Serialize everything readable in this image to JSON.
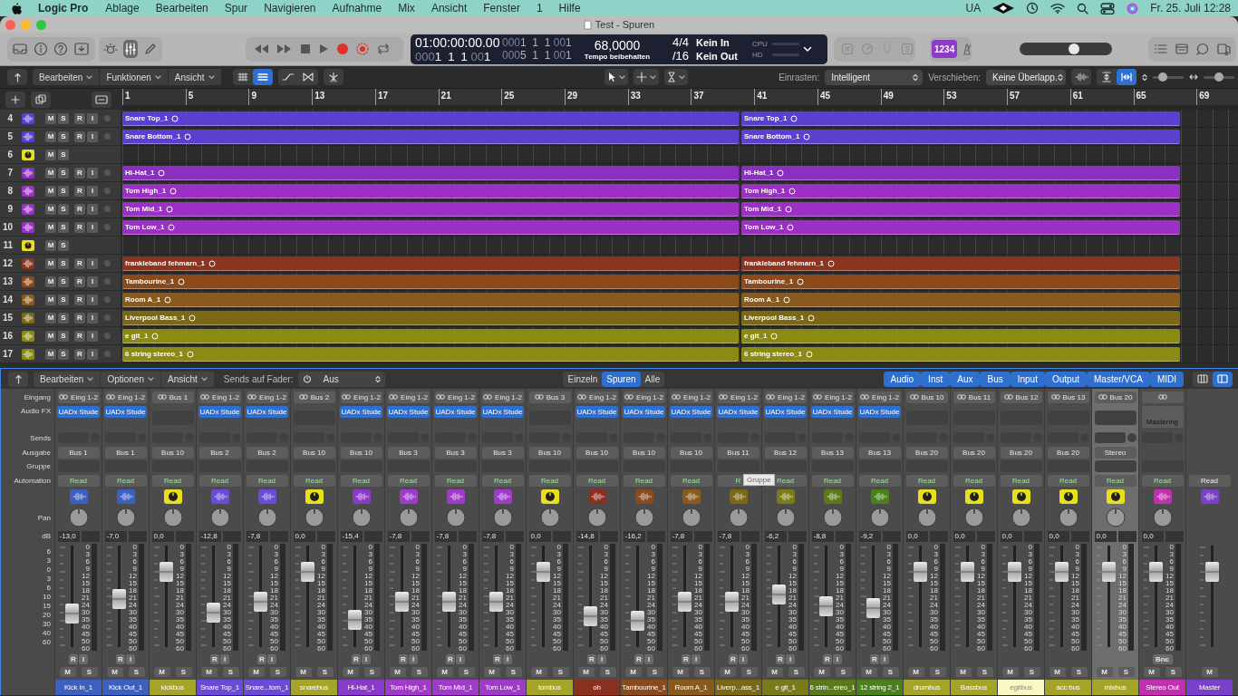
{
  "menubar": {
    "app": "Logic Pro",
    "menus": [
      "Ablage",
      "Bearbeiten",
      "Spur",
      "Navigieren",
      "Aufnahme",
      "Mix",
      "Ansicht",
      "Fenster",
      "1",
      "Hilfe"
    ],
    "status_text": "UA",
    "clock": "Fr. 25. Juli 12:28"
  },
  "window": {
    "title": "Test - Spuren"
  },
  "toolbar": {
    "view_buttons": [
      {
        "kind": "brightness",
        "selected": false
      },
      {
        "kind": "mixer",
        "selected": true
      },
      {
        "kind": "pencil",
        "selected": false
      }
    ],
    "lcd": {
      "time": "01:00:00:00.00",
      "position": [
        {
          "text": "000",
          "dim": true
        },
        {
          "text": "1  1  1 ",
          "dim": false
        },
        {
          "text": "00",
          "dim": true
        },
        {
          "text": "1",
          "dim": false
        }
      ],
      "locator_left": [
        {
          "text": "000",
          "dim": true
        },
        {
          "text": "1  1  1 ",
          "dim": false
        },
        {
          "text": "00",
          "dim": true
        },
        {
          "text": "1",
          "dim": false
        }
      ],
      "locator_right": [
        {
          "text": "000",
          "dim": true
        },
        {
          "text": "5  1  1 ",
          "dim": false
        },
        {
          "text": "00",
          "dim": true
        },
        {
          "text": "1",
          "dim": false
        }
      ],
      "tempo": "68,0000",
      "tempo_mode": "Tempo beibehalten",
      "signature": "4/4",
      "division": "/16",
      "midi_in": "Kein In",
      "midi_out": "Kein Out",
      "cpu_label": "CPU",
      "hd_label": "HD"
    },
    "count_in": {
      "label": "1234",
      "on": true
    },
    "master_volume": {
      "level": 0.6
    }
  },
  "tracks_toolbar": {
    "menus": [
      "Bearbeiten",
      "Funktionen",
      "Ansicht"
    ],
    "view_modes": [
      {
        "selected": false
      },
      {
        "selected": true
      }
    ],
    "snap_label": "Einrasten:",
    "snap_value": "Intelligent",
    "drag_label": "Verschieben:",
    "drag_value": "Keine Überlapp.",
    "fit_buttons": [
      {
        "selected": false
      },
      {
        "selected": true
      }
    ],
    "zoom_sliders": [
      {
        "level": 0.25
      },
      {
        "level": 0.5
      }
    ]
  },
  "ruler": {
    "bars": [
      "1",
      "5",
      "9",
      "13",
      "17",
      "21",
      "25",
      "29",
      "33",
      "37",
      "41",
      "45",
      "49",
      "53",
      "57",
      "61",
      "65",
      "69"
    ]
  },
  "tracks": [
    {
      "number": "4",
      "kind": "audio",
      "color": "#5b3fd0",
      "buttons": [
        "M",
        "S",
        "R",
        "I"
      ],
      "regions": [
        {
          "name": "Snare Top_1"
        },
        {
          "name": "Snare Top_1"
        }
      ]
    },
    {
      "number": "5",
      "kind": "audio",
      "color": "#5b3fd0",
      "buttons": [
        "M",
        "S",
        "R",
        "I"
      ],
      "regions": [
        {
          "name": "Snare Bottom_1"
        },
        {
          "name": "Snare Bottom_1"
        }
      ]
    },
    {
      "number": "6",
      "kind": "aux",
      "buttons": [
        "M",
        "S"
      ]
    },
    {
      "number": "7",
      "kind": "audio",
      "color": "#8a2fc0",
      "buttons": [
        "M",
        "S",
        "R",
        "I"
      ],
      "regions": [
        {
          "name": "Hi-Hat_1"
        },
        {
          "name": "Hi-Hat_1"
        }
      ]
    },
    {
      "number": "8",
      "kind": "audio",
      "color": "#9c2fc4",
      "buttons": [
        "M",
        "S",
        "R",
        "I"
      ],
      "regions": [
        {
          "name": "Tom High_1"
        },
        {
          "name": "Tom High_1"
        }
      ]
    },
    {
      "number": "9",
      "kind": "audio",
      "color": "#9c2fc4",
      "buttons": [
        "M",
        "S",
        "R",
        "I"
      ],
      "regions": [
        {
          "name": "Tom Mid_1"
        },
        {
          "name": "Tom Mid_1"
        }
      ]
    },
    {
      "number": "10",
      "kind": "audio",
      "color": "#9c2fc4",
      "buttons": [
        "M",
        "S",
        "R",
        "I"
      ],
      "regions": [
        {
          "name": "Tom Low_1"
        },
        {
          "name": "Tom Low_1"
        }
      ]
    },
    {
      "number": "11",
      "kind": "aux",
      "buttons": [
        "M",
        "S"
      ]
    },
    {
      "number": "12",
      "kind": "audio",
      "color": "#8a3520",
      "buttons": [
        "M",
        "S",
        "R",
        "I"
      ],
      "regions": [
        {
          "name": "frankleband fehmarn_1"
        },
        {
          "name": "frankleband fehmarn_1"
        }
      ]
    },
    {
      "number": "13",
      "kind": "audio",
      "color": "#8a4a1c",
      "buttons": [
        "M",
        "S",
        "R",
        "I"
      ],
      "regions": [
        {
          "name": "Tambourine_1"
        },
        {
          "name": "Tambourine_1"
        }
      ]
    },
    {
      "number": "14",
      "kind": "audio",
      "color": "#8a5a1c",
      "buttons": [
        "M",
        "S",
        "R",
        "I"
      ],
      "regions": [
        {
          "name": "Room A_1"
        },
        {
          "name": "Room A_1"
        }
      ]
    },
    {
      "number": "15",
      "kind": "audio",
      "color": "#7a6814",
      "buttons": [
        "M",
        "S",
        "R",
        "I"
      ],
      "regions": [
        {
          "name": "Liverpool Bass_1"
        },
        {
          "name": "Liverpool Bass_1"
        }
      ]
    },
    {
      "number": "16",
      "kind": "audio",
      "color": "#8a8a14",
      "buttons": [
        "M",
        "S",
        "R",
        "I"
      ],
      "regions": [
        {
          "name": "e git_1"
        },
        {
          "name": "e git_1"
        }
      ]
    },
    {
      "number": "17",
      "kind": "audio",
      "color": "#8a8a14",
      "buttons": [
        "M",
        "S",
        "R",
        "I"
      ],
      "regions": [
        {
          "name": "6 string stereo_1"
        },
        {
          "name": "6 string stereo_1"
        }
      ]
    }
  ],
  "mixer": {
    "menus": [
      "Bearbeiten",
      "Optionen",
      "Ansicht"
    ],
    "sends_label": "Sends auf Fader:",
    "sends_value": "Aus",
    "view_tabs": [
      {
        "label": "Einzeln",
        "selected": false
      },
      {
        "label": "Spuren",
        "selected": true
      },
      {
        "label": "Alle",
        "selected": false
      }
    ],
    "filters": [
      {
        "label": "Audio",
        "selected": true
      },
      {
        "label": "Inst",
        "selected": true
      },
      {
        "label": "Aux",
        "selected": true
      },
      {
        "label": "Bus",
        "selected": true
      },
      {
        "label": "Input",
        "selected": true
      },
      {
        "label": "Output",
        "selected": true
      },
      {
        "label": "Master/VCA",
        "selected": true
      },
      {
        "label": "MIDI",
        "selected": true
      }
    ],
    "layout_buttons": [
      {
        "selected": false
      },
      {
        "selected": true
      }
    ],
    "row_labels": [
      "Eingang",
      "Audio FX",
      "Sends",
      "Ausgabe",
      "Gruppe",
      "Automation",
      "Pan",
      "dB"
    ],
    "fader_scale": [
      "6",
      "3",
      "0",
      "3",
      "6",
      "10",
      "15",
      "20",
      "30",
      "40",
      "60"
    ],
    "strips": [
      {
        "name": "Kick In_1",
        "color": "#3d5fc2",
        "kind": "audio",
        "selected": false,
        "input": "Eing 1-2",
        "fx": "UADx Stude",
        "output": "Bus 1",
        "automation": "Read",
        "db": "-13,0",
        "level": 0.33,
        "ri": [
          "R",
          "I"
        ],
        "ms": [
          "M",
          "S"
        ],
        "meter_scale": [
          "0",
          "3",
          "6",
          "9",
          "12",
          "15",
          "18",
          "21",
          "24",
          "30",
          "35",
          "40",
          "45",
          "50",
          "60"
        ]
      },
      {
        "name": "Kick Out_1",
        "color": "#3d5fc2",
        "kind": "audio",
        "selected": false,
        "input": "Eing 1-2",
        "fx": "UADx Stude",
        "output": "Bus 1",
        "automation": "Read",
        "db": "-7,0",
        "level": 0.47,
        "ri": [
          "R",
          "I"
        ],
        "ms": [
          "M",
          "S"
        ],
        "meter_scale": [
          "0",
          "3",
          "6",
          "9",
          "12",
          "15",
          "18",
          "21",
          "24",
          "30",
          "35",
          "40",
          "45",
          "50",
          "60"
        ]
      },
      {
        "name": "kickbus",
        "color": "#a4a428",
        "kind": "aux",
        "selected": false,
        "input": "Bus 1",
        "output": "Bus 10",
        "automation": "Read",
        "db": "0,0",
        "level": 0.74,
        "ms": [
          "M",
          "S"
        ],
        "meter_scale": [
          "0",
          "3",
          "6",
          "9",
          "12",
          "15",
          "18",
          "21",
          "24",
          "30",
          "35",
          "40",
          "45",
          "50",
          "60"
        ]
      },
      {
        "name": "Snare Top_1",
        "color": "#6a4ad8",
        "kind": "audio",
        "selected": false,
        "input": "Eing 1-2",
        "fx": "UADx Stude",
        "output": "Bus 2",
        "automation": "Read",
        "db": "-12,8",
        "level": 0.34,
        "ri": [
          "R",
          "I"
        ],
        "ms": [
          "M",
          "S"
        ],
        "meter_scale": [
          "0",
          "3",
          "6",
          "9",
          "12",
          "15",
          "18",
          "21",
          "24",
          "30",
          "35",
          "40",
          "45",
          "50",
          "60"
        ]
      },
      {
        "name": "Snare...tom_1",
        "color": "#6a4ad8",
        "kind": "audio",
        "selected": false,
        "input": "Eing 1-2",
        "fx": "UADx Stude",
        "output": "Bus 2",
        "automation": "Read",
        "db": "-7,8",
        "level": 0.45,
        "ri": [
          "R",
          "I"
        ],
        "ms": [
          "M",
          "S"
        ],
        "meter_scale": [
          "0",
          "3",
          "6",
          "9",
          "12",
          "15",
          "18",
          "21",
          "24",
          "30",
          "35",
          "40",
          "45",
          "50",
          "60"
        ]
      },
      {
        "name": "snarebus",
        "color": "#a4a428",
        "kind": "aux",
        "selected": false,
        "input": "Bus 2",
        "output": "Bus 10",
        "automation": "Read",
        "db": "0,0",
        "level": 0.74,
        "ms": [
          "M",
          "S"
        ],
        "meter_scale": [
          "0",
          "3",
          "6",
          "9",
          "12",
          "15",
          "18",
          "21",
          "24",
          "30",
          "35",
          "40",
          "45",
          "50",
          "60"
        ]
      },
      {
        "name": "Hi-Hat_1",
        "color": "#8a3ac8",
        "kind": "audio",
        "selected": false,
        "input": "Eing 1-2",
        "fx": "UADx Stude",
        "output": "Bus 10",
        "automation": "Read",
        "db": "-15,4",
        "level": 0.27,
        "ri": [
          "R",
          "I"
        ],
        "ms": [
          "M",
          "S"
        ],
        "meter_scale": [
          "0",
          "3",
          "6",
          "9",
          "12",
          "15",
          "18",
          "21",
          "24",
          "30",
          "35",
          "40",
          "45",
          "50",
          "60"
        ]
      },
      {
        "name": "Tom High_1",
        "color": "#a03ac8",
        "kind": "audio",
        "selected": false,
        "input": "Eing 1-2",
        "fx": "UADx Stude",
        "output": "Bus 3",
        "automation": "Read",
        "db": "-7,8",
        "level": 0.45,
        "ri": [
          "R",
          "I"
        ],
        "ms": [
          "M",
          "S"
        ],
        "meter_scale": [
          "0",
          "3",
          "6",
          "9",
          "12",
          "15",
          "18",
          "21",
          "24",
          "30",
          "35",
          "40",
          "45",
          "50",
          "60"
        ]
      },
      {
        "name": "Tom Mid_1",
        "color": "#a03ac8",
        "kind": "audio",
        "selected": false,
        "input": "Eing 1-2",
        "fx": "UADx Stude",
        "output": "Bus 3",
        "automation": "Read",
        "db": "-7,8",
        "level": 0.45,
        "ri": [
          "R",
          "I"
        ],
        "ms": [
          "M",
          "S"
        ],
        "meter_scale": [
          "0",
          "3",
          "6",
          "9",
          "12",
          "15",
          "18",
          "21",
          "24",
          "30",
          "35",
          "40",
          "45",
          "50",
          "60"
        ]
      },
      {
        "name": "Tom Low_1",
        "color": "#a03ac8",
        "kind": "audio",
        "selected": false,
        "input": "Eing 1-2",
        "fx": "UADx Stude",
        "output": "Bus 3",
        "automation": "Read",
        "db": "-7,8",
        "level": 0.45,
        "ri": [
          "R",
          "I"
        ],
        "ms": [
          "M",
          "S"
        ],
        "meter_scale": [
          "0",
          "3",
          "6",
          "9",
          "12",
          "15",
          "18",
          "21",
          "24",
          "30",
          "35",
          "40",
          "45",
          "50",
          "60"
        ]
      },
      {
        "name": "tombus",
        "color": "#a4a428",
        "kind": "aux",
        "selected": false,
        "input": "Bus 3",
        "output": "Bus 10",
        "automation": "Read",
        "db": "0,0",
        "level": 0.74,
        "ms": [
          "M",
          "S"
        ],
        "meter_scale": [
          "0",
          "3",
          "6",
          "9",
          "12",
          "15",
          "18",
          "21",
          "24",
          "30",
          "35",
          "40",
          "45",
          "50",
          "60"
        ]
      },
      {
        "name": "oh",
        "color": "#8a3020",
        "kind": "audio",
        "selected": false,
        "input": "Eing 1-2",
        "fx": "UADx Stude",
        "output": "Bus 10",
        "automation": "Read",
        "db": "-14,8",
        "level": 0.3,
        "ri": [
          "R",
          "I"
        ],
        "ms": [
          "M",
          "S"
        ],
        "meter_scale": [
          "0",
          "3",
          "6",
          "9",
          "12",
          "15",
          "18",
          "21",
          "24",
          "30",
          "35",
          "40",
          "45",
          "50",
          "60"
        ]
      },
      {
        "name": "Tambourine_1",
        "color": "#8a4a1c",
        "kind": "audio",
        "selected": false,
        "input": "Eing 1-2",
        "fx": "UADx Stude",
        "output": "Bus 10",
        "automation": "Read",
        "db": "-16,2",
        "level": 0.26,
        "ri": [
          "R",
          "I"
        ],
        "ms": [
          "M",
          "S"
        ],
        "meter_scale": [
          "0",
          "3",
          "6",
          "9",
          "12",
          "15",
          "18",
          "21",
          "24",
          "30",
          "35",
          "40",
          "45",
          "50",
          "60"
        ]
      },
      {
        "name": "Room A_1",
        "color": "#8a5a1c",
        "kind": "audio",
        "selected": false,
        "input": "Eing 1-2",
        "fx": "UADx Stude",
        "output": "Bus 10",
        "automation": "Read",
        "db": "-7,8",
        "level": 0.45,
        "ri": [
          "R",
          "I"
        ],
        "ms": [
          "M",
          "S"
        ],
        "meter_scale": [
          "0",
          "3",
          "6",
          "9",
          "12",
          "15",
          "18",
          "21",
          "24",
          "30",
          "35",
          "40",
          "45",
          "50",
          "60"
        ]
      },
      {
        "name": "Liverp...ass_1",
        "color": "#7a6814",
        "kind": "audio",
        "selected": false,
        "input": "Eing 1-2",
        "fx": "UADx Stude",
        "output": "Bus 11",
        "automation": "R",
        "tooltip": "Gruppe",
        "db": "-7,8",
        "level": 0.45,
        "ri": [
          "R",
          "I"
        ],
        "ms": [
          "M",
          "S"
        ],
        "meter_scale": [
          "0",
          "3",
          "6",
          "9",
          "12",
          "15",
          "18",
          "21",
          "24",
          "30",
          "35",
          "40",
          "45",
          "50",
          "60"
        ]
      },
      {
        "name": "e git_1",
        "color": "#7a7a18",
        "kind": "audio",
        "selected": false,
        "input": "Eing 1-2",
        "fx": "UADx Stude",
        "output": "Bus 12",
        "automation": "Read",
        "db": "-6,2",
        "level": 0.52,
        "ri": [
          "R",
          "I"
        ],
        "ms": [
          "M",
          "S"
        ],
        "meter_scale": [
          "0",
          "3",
          "6",
          "9",
          "12",
          "15",
          "18",
          "21",
          "24",
          "30",
          "35",
          "40",
          "45",
          "50",
          "60"
        ]
      },
      {
        "name": "6 strin...ereo_1",
        "color": "#5a7a18",
        "kind": "audio",
        "selected": false,
        "input": "Eing 1-2",
        "fx": "UADx Stude",
        "output": "Bus 13",
        "automation": "Read",
        "db": "-8,8",
        "level": 0.4,
        "ri": [
          "R",
          "I"
        ],
        "ms": [
          "M",
          "S"
        ],
        "meter_scale": [
          "0",
          "3",
          "6",
          "9",
          "12",
          "15",
          "18",
          "21",
          "24",
          "30",
          "35",
          "40",
          "45",
          "50",
          "60"
        ]
      },
      {
        "name": "12 string 2_1",
        "color": "#4a8018",
        "kind": "audio",
        "selected": false,
        "input": "Eing 1-2",
        "fx": "UADx Stude",
        "output": "Bus 13",
        "automation": "Read",
        "db": "-9,2",
        "level": 0.38,
        "ri": [
          "R",
          "I"
        ],
        "ms": [
          "M",
          "S"
        ],
        "meter_scale": [
          "0",
          "3",
          "6",
          "9",
          "12",
          "15",
          "18",
          "21",
          "24",
          "30",
          "35",
          "40",
          "45",
          "50",
          "60"
        ]
      },
      {
        "name": "drumbus",
        "color": "#a4a428",
        "kind": "aux",
        "selected": false,
        "input": "Bus 10",
        "output": "Bus 20",
        "automation": "Read",
        "db": "0,0",
        "level": 0.74,
        "ms": [
          "M",
          "S"
        ],
        "meter_scale": [
          "0",
          "3",
          "6",
          "9",
          "12",
          "15",
          "18",
          "21",
          "24",
          "30",
          "35",
          "40",
          "45",
          "50",
          "60"
        ]
      },
      {
        "name": "Bassbus",
        "color": "#a4a428",
        "kind": "aux",
        "selected": false,
        "input": "Bus 11",
        "output": "Bus 20",
        "automation": "Read",
        "db": "0,0",
        "level": 0.74,
        "ms": [
          "M",
          "S"
        ],
        "meter_scale": [
          "0",
          "3",
          "6",
          "9",
          "12",
          "15",
          "18",
          "21",
          "24",
          "30",
          "35",
          "40",
          "45",
          "50",
          "60"
        ]
      },
      {
        "name": "egitbus",
        "color": "#fbf7c4",
        "kind": "aux",
        "selected": false,
        "input": "Bus 12",
        "output": "Bus 20",
        "automation": "Read",
        "db": "0,0",
        "level": 0.74,
        "ms": [
          "M",
          "S"
        ],
        "meter_scale": [
          "0",
          "3",
          "6",
          "9",
          "12",
          "15",
          "18",
          "21",
          "24",
          "30",
          "35",
          "40",
          "45",
          "50",
          "60"
        ]
      },
      {
        "name": "acc bus",
        "color": "#a4a428",
        "kind": "aux",
        "selected": false,
        "input": "Bus 13",
        "output": "Bus 20",
        "automation": "Read",
        "db": "0,0",
        "level": 0.74,
        "ms": [
          "M",
          "S"
        ],
        "meter_scale": [
          "0",
          "3",
          "6",
          "9",
          "12",
          "15",
          "18",
          "21",
          "24",
          "30",
          "35",
          "40",
          "45",
          "50",
          "60"
        ]
      },
      {
        "name": "mixbus",
        "color": "#a4a428",
        "kind": "aux",
        "selected": true,
        "input": "Bus 20",
        "output": "Stereo",
        "automation": "Read",
        "db": "0,0",
        "level": 0.74,
        "ms": [
          "M",
          "S"
        ],
        "meter_scale": [
          "0",
          "3",
          "6",
          "9",
          "12",
          "15",
          "18",
          "21",
          "24",
          "30",
          "35",
          "40",
          "45",
          "50",
          "60"
        ]
      },
      {
        "name": "Stereo Out",
        "color": "#c030b0",
        "kind": "output",
        "selected": false,
        "fx": "Mastering",
        "automation": "Read",
        "db": "0,0",
        "level": 0.74,
        "bnc": "Bnc",
        "ms": [
          "M",
          "S"
        ],
        "meter_scale": [
          "0",
          "3",
          "6",
          "9",
          "12",
          "15",
          "18",
          "21",
          "24",
          "30",
          "35",
          "40",
          "45",
          "50",
          "60"
        ]
      },
      {
        "name": "Master",
        "color": "#7a40c8",
        "kind": "master",
        "selected": false,
        "automation": "Read",
        "level": 0.74,
        "ms": [
          "M"
        ]
      }
    ]
  }
}
